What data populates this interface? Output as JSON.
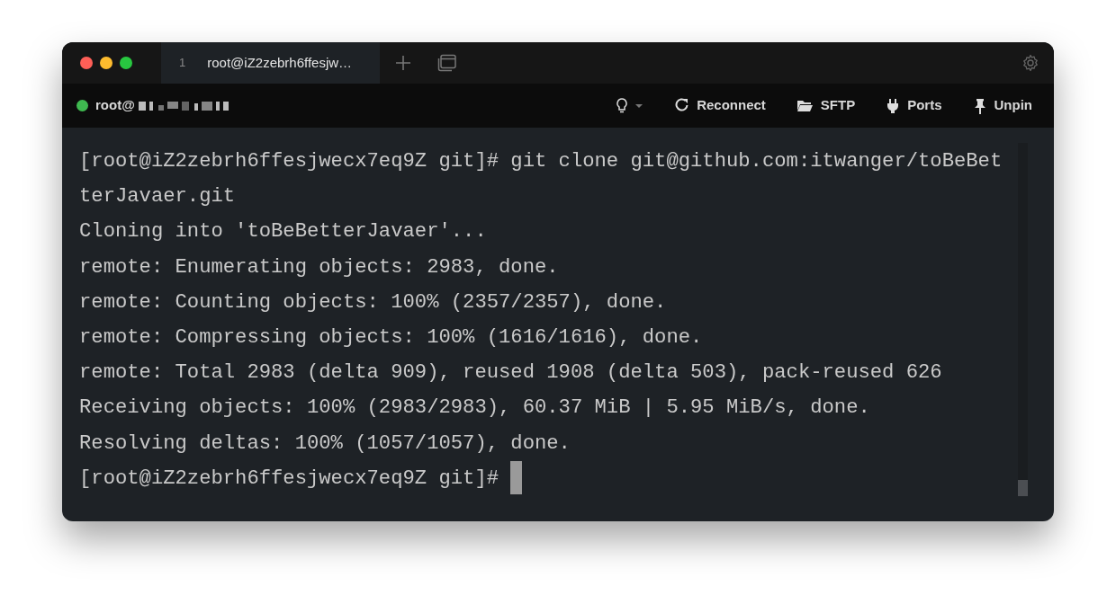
{
  "tabs": [
    {
      "number": "1",
      "label": "root@iZ2zebrh6ffesjw…",
      "selected": true
    }
  ],
  "toolbar": {
    "connected": true,
    "user": "root@",
    "actions": [
      {
        "kind": "reconnect",
        "label": "Reconnect"
      },
      {
        "kind": "sftp",
        "label": "SFTP"
      },
      {
        "kind": "ports",
        "label": "Ports"
      },
      {
        "kind": "unpin",
        "label": "Unpin"
      }
    ]
  },
  "terminal": {
    "lines": [
      "[root@iZ2zebrh6ffesjwecx7eq9Z git]# git clone git@github.com:itwanger/toBeBet",
      "terJavaer.git",
      "Cloning into 'toBeBetterJavaer'...",
      "remote: Enumerating objects: 2983, done.",
      "remote: Counting objects: 100% (2357/2357), done.",
      "remote: Compressing objects: 100% (1616/1616), done.",
      "remote: Total 2983 (delta 909), reused 1908 (delta 503), pack-reused 626",
      "Receiving objects: 100% (2983/2983), 60.37 MiB | 5.95 MiB/s, done.",
      "Resolving deltas: 100% (1057/1057), done.",
      "[root@iZ2zebrh6ffesjwecx7eq9Z git]# "
    ],
    "cursor": true
  }
}
